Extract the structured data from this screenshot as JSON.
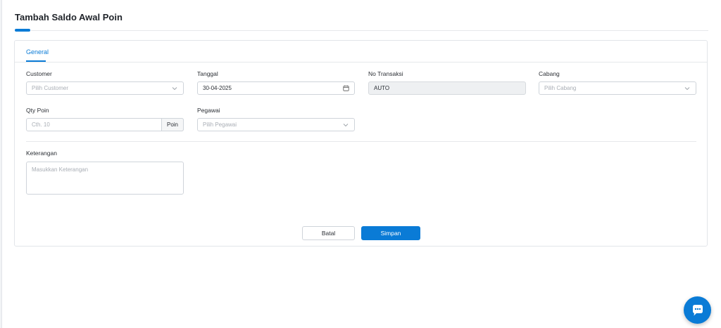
{
  "page": {
    "title": "Tambah Saldo Awal Poin"
  },
  "tabs": [
    {
      "label": "General",
      "active": true
    }
  ],
  "form": {
    "customer": {
      "label": "Customer",
      "placeholder": "Pilih Customer"
    },
    "tanggal": {
      "label": "Tanggal",
      "value": "30-04-2025"
    },
    "no_transaksi": {
      "label": "No Transaksi",
      "value": "AUTO"
    },
    "cabang": {
      "label": "Cabang",
      "placeholder": "Pilih Cabang"
    },
    "qty_poin": {
      "label": "Qty Poin",
      "placeholder": "Cth. 10",
      "addon": "Poin"
    },
    "pegawai": {
      "label": "Pegawai",
      "placeholder": "Pilih Pegawai"
    },
    "keterangan": {
      "label": "Keterangan",
      "placeholder": "Masukkan Keterangan"
    }
  },
  "actions": {
    "cancel_label": "Batal",
    "save_label": "Simpan"
  },
  "icons": {
    "dropdown": "chevron-down-icon",
    "date": "calendar-icon",
    "chat": "chat-bubble-icon"
  },
  "colors": {
    "accent": "#0a7bd6"
  }
}
